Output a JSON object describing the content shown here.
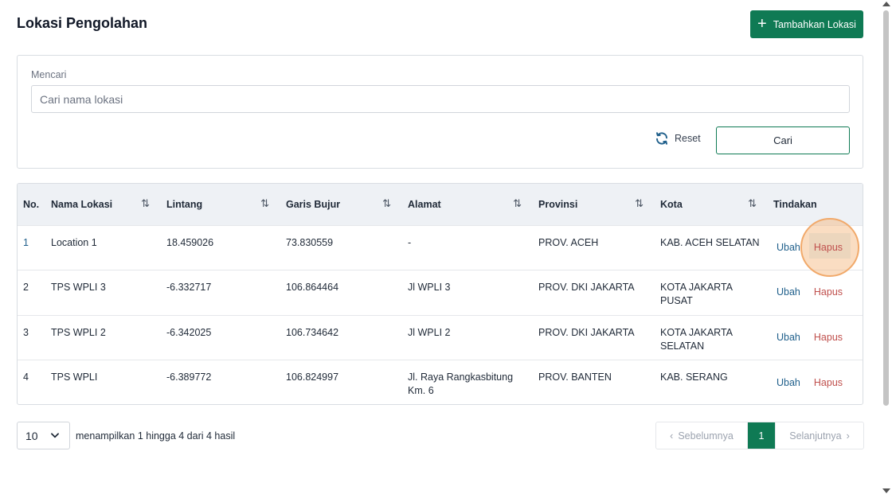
{
  "header": {
    "title": "Lokasi Pengolahan",
    "add_button_label": "Tambahkan Lokasi"
  },
  "search": {
    "label": "Mencari",
    "placeholder": "Cari nama lokasi",
    "value": "",
    "reset_label": "Reset",
    "search_label": "Cari"
  },
  "table": {
    "headers": [
      "No.",
      "Nama Lokasi",
      "Lintang",
      "Garis Bujur",
      "Alamat",
      "Provinsi",
      "Kota",
      "Tindakan"
    ],
    "rows": [
      {
        "no": "1",
        "name": "Location 1",
        "lat": "18.459026",
        "lng": "73.830559",
        "address": "-",
        "province": "PROV. ACEH",
        "city": "KAB. ACEH SELATAN",
        "edit": "Ubah",
        "delete": "Hapus"
      },
      {
        "no": "2",
        "name": "TPS WPLI 3",
        "lat": "-6.332717",
        "lng": "106.864464",
        "address": "Jl WPLI 3",
        "province": "PROV. DKI JAKARTA",
        "city": "KOTA JAKARTA PUSAT",
        "edit": "Ubah",
        "delete": "Hapus"
      },
      {
        "no": "3",
        "name": "TPS WPLI 2",
        "lat": "-6.342025",
        "lng": "106.734642",
        "address": "Jl WPLI 2",
        "province": "PROV. DKI JAKARTA",
        "city": "KOTA JAKARTA SELATAN",
        "edit": "Ubah",
        "delete": "Hapus"
      },
      {
        "no": "4",
        "name": "TPS WPLI",
        "lat": "-6.389772",
        "lng": "106.824997",
        "address": "Jl. Raya Rangkasbitung Km. 6",
        "province": "PROV. BANTEN",
        "city": "KAB. SERANG",
        "edit": "Ubah",
        "delete": "Hapus"
      }
    ]
  },
  "footer": {
    "per_page": "10",
    "summary": "menampilkan 1 hingga 4 dari 4 hasil",
    "prev_label": "Sebelumnya",
    "current_page": "1",
    "next_label": "Selanjutnya"
  },
  "colors": {
    "primary": "#0f7a54",
    "edit_link": "#1f5f8b",
    "delete_link": "#c0504d",
    "header_bg": "#eef1f5"
  }
}
